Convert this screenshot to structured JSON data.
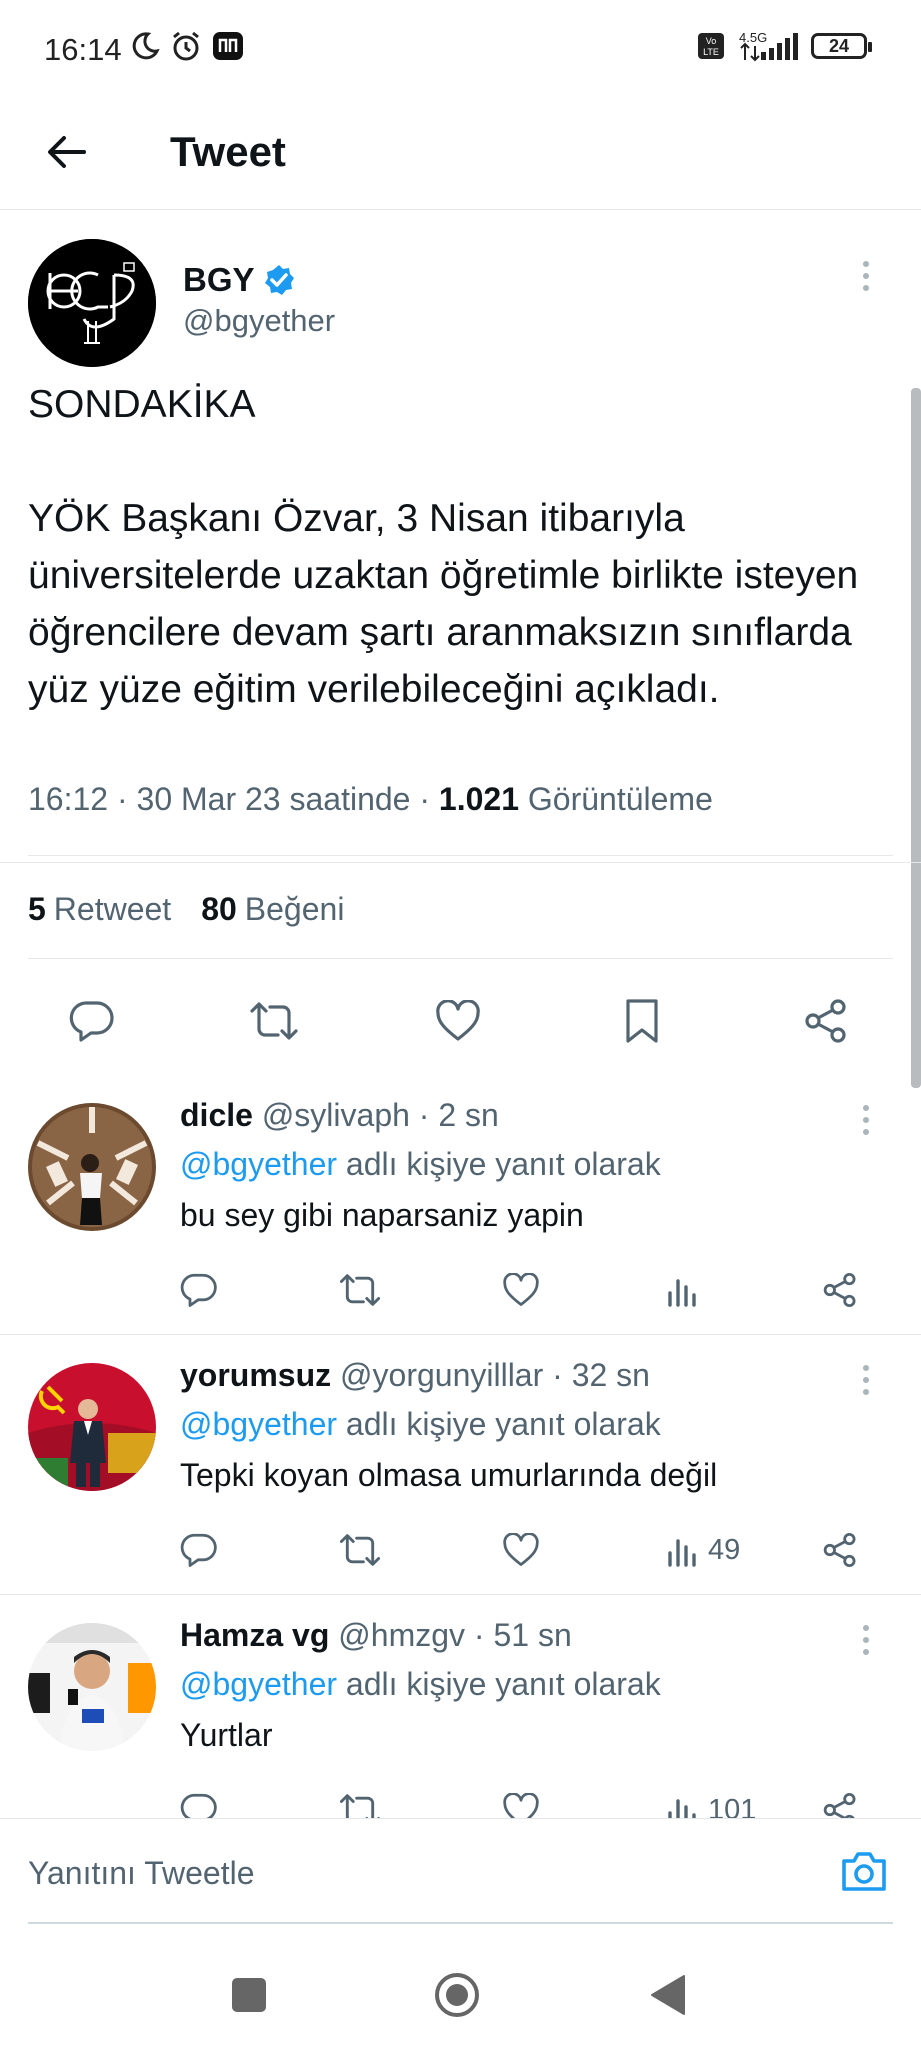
{
  "status_bar": {
    "time": "16:14",
    "network_label": "4.5G",
    "volte_label": "Vo LTE",
    "battery": "24"
  },
  "header": {
    "title": "Tweet"
  },
  "main_tweet": {
    "author_name": "BGY",
    "author_handle": "@bgyether",
    "text_line1": "SONDAKİKA",
    "text_body": "YÖK Başkanı Özvar, 3 Nisan itibarıyla üniversitelerde uzaktan öğretimle birlikte isteyen öğrencilere devam şartı aranmaksızın sınıflarda yüz yüze eğitim verilebileceğini açıkladı.",
    "time": "16:12",
    "date": "30 Mar 23 saatinde",
    "views_count": "1.021",
    "views_label": "Görüntüleme",
    "retweet_count": "5",
    "retweet_label": "Retweet",
    "like_count": "80",
    "like_label": "Beğeni",
    "accent_color": "#1d9bf0"
  },
  "replies": [
    {
      "name": "dicle",
      "handle": "@sylivaph",
      "time": "· 2 sn",
      "reply_to_mention": "@bgyether",
      "reply_to_suffix": "adlı kişiye yanıt olarak",
      "text": "bu sey gibi naparsaniz yapin",
      "views": ""
    },
    {
      "name": "yorumsuz",
      "handle": "@yorgunyilllar",
      "time": "· 32 sn",
      "reply_to_mention": "@bgyether",
      "reply_to_suffix": "adlı kişiye yanıt olarak",
      "text": "Tepki koyan olmasa umurlarında değil",
      "views": "49"
    },
    {
      "name": "Hamza vg",
      "handle": "@hmzgv",
      "time": "· 51 sn",
      "reply_to_mention": "@bgyether",
      "reply_to_suffix": "adlı kişiye yanıt olarak",
      "text": "Yurtlar",
      "views": "101"
    }
  ],
  "compose": {
    "placeholder": "Yanıtını Tweetle"
  }
}
